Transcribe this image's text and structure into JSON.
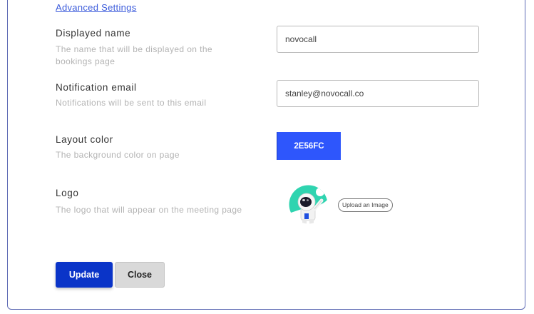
{
  "advanced_settings_link": "Advanced Settings",
  "displayed_name": {
    "label": "Displayed name",
    "hint": "The name that will be displayed on the bookings page",
    "value": "novocall"
  },
  "notification_email": {
    "label": "Notification email",
    "hint": "Notifications will be sent to this email",
    "value": "stanley@novocall.co"
  },
  "layout_color": {
    "label": "Layout color",
    "hint": "The background color on page",
    "value": "2E56FC",
    "color": "#2E56FC"
  },
  "logo": {
    "label": "Logo",
    "hint": "The logo that will appear on the meeting page",
    "icon": "astronaut-logo-icon",
    "upload_label": "Upload an Image"
  },
  "actions": {
    "update_label": "Update",
    "close_label": "Close"
  },
  "colors": {
    "accent": "#0a34c8",
    "border": "#5f6bb5",
    "logo_bg": "#2fd4b0"
  }
}
